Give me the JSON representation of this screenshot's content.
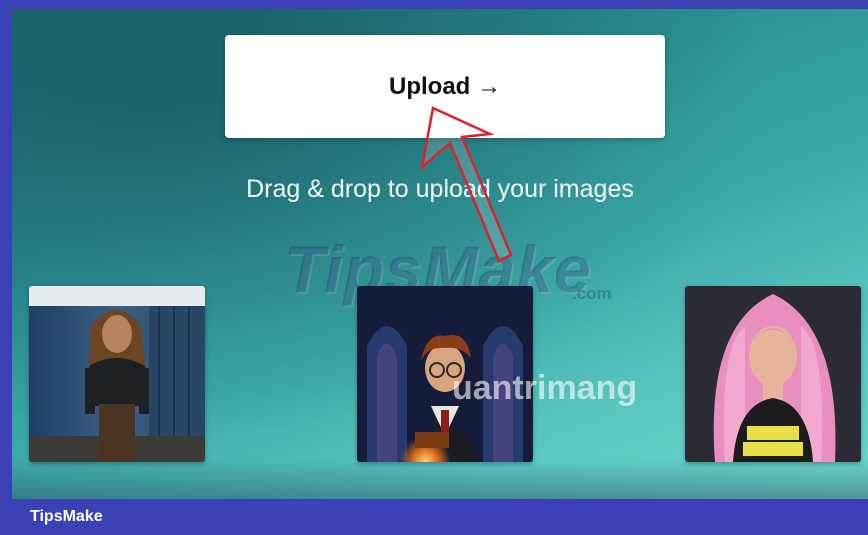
{
  "upload": {
    "label": "Upload →"
  },
  "hint": "Drag & drop to upload your images",
  "watermarks": {
    "tipsmake": "TipsMake",
    "tipsmake_domain": ".com",
    "quantrimang": "uantrimang"
  },
  "gallery": {
    "images": [
      {
        "subject": "woman in dark shirt standing by blue wall"
      },
      {
        "subject": "boy wizard with glasses holding glowing book"
      },
      {
        "subject": "woman with pink hair"
      }
    ]
  },
  "footer": {
    "brand": "TipsMake"
  },
  "colors": {
    "frame": "#3b40b4",
    "annotation_arrow": "#e0202a",
    "button_bg": "#ffffff"
  }
}
